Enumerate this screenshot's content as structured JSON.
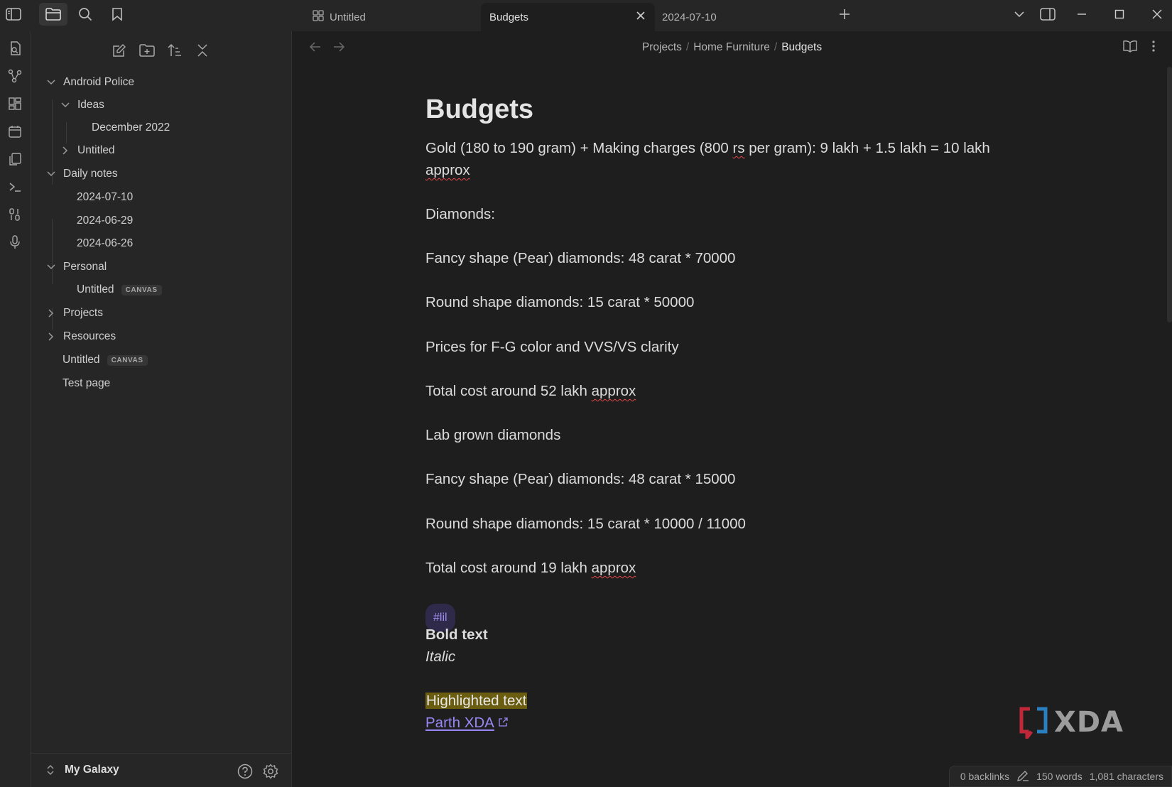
{
  "tabs": [
    {
      "label": "Untitled",
      "icon": "canvas-grid-icon",
      "active": false
    },
    {
      "label": "Budgets",
      "active": true
    },
    {
      "label": "2024-07-10",
      "active": false
    }
  ],
  "sidebar": {
    "tree": [
      {
        "label": "Android Police",
        "badge": ""
      },
      {
        "label": "Ideas",
        "badge": ""
      },
      {
        "label": "December 2022",
        "badge": ""
      },
      {
        "label": "Untitled",
        "badge": ""
      },
      {
        "label": "Daily notes",
        "badge": ""
      },
      {
        "label": "2024-07-10",
        "badge": ""
      },
      {
        "label": "2024-06-29",
        "badge": ""
      },
      {
        "label": "2024-06-26",
        "badge": ""
      },
      {
        "label": "Personal",
        "badge": ""
      },
      {
        "label": "Untitled",
        "badge": "CANVAS"
      },
      {
        "label": "Projects",
        "badge": ""
      },
      {
        "label": "Resources",
        "badge": ""
      },
      {
        "label": "Untitled",
        "badge": "CANVAS"
      },
      {
        "label": "Test page",
        "badge": ""
      }
    ],
    "vault_name": "My Galaxy"
  },
  "breadcrumb": [
    "Projects",
    "Home Furniture",
    "Budgets"
  ],
  "document": {
    "title": "Budgets",
    "gold_line_a": "Gold (180 to 190 gram) + Making charges (800 ",
    "gold_rs": "rs",
    "gold_line_b": " per gram): 9 lakh + 1.5 lakh = 10 lakh ",
    "gold_approx": "approx",
    "diamonds": "Diamonds:",
    "fancy_1": "Fancy shape (Pear) diamonds: 48 carat * 70000",
    "round_1": "Round shape diamonds: 15 carat * 50000",
    "prices": "Prices for F-G color and VVS/VS clarity",
    "total_1_a": "Total cost around 52 lakh ",
    "total_1_b": "approx",
    "lab": "Lab grown diamonds",
    "fancy_2": "Fancy shape (Pear) diamonds: 48 carat * 15000",
    "round_2": "Round shape diamonds: 15 carat * 10000 / 11000",
    "total_2_a": "Total cost around 19 lakh ",
    "total_2_b": "approx",
    "tag": "#lil",
    "bold": "Bold text",
    "italic": "Italic",
    "highlight": "Highlighted text",
    "link": "Parth XDA"
  },
  "status": {
    "backlinks": "0 backlinks",
    "words": "150 words",
    "characters": "1,081 characters"
  },
  "watermark": "XDA"
}
